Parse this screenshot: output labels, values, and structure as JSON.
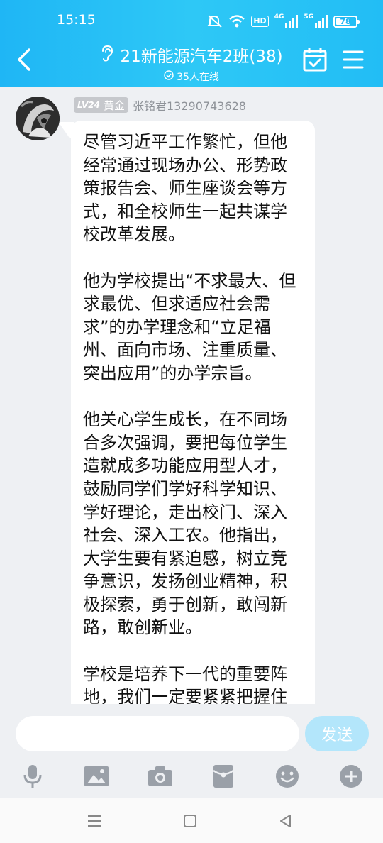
{
  "status_bar": {
    "time": "15:15",
    "network_hd": "HD",
    "net_4g": "4G",
    "net_5g": "5G",
    "battery": "78",
    "battery_level": 0.78
  },
  "header": {
    "title": "21新能源汽车2班(38)",
    "online": "35人在线"
  },
  "message": {
    "level": "LV24",
    "rank": "黄金",
    "sender": "张铭君13290743628",
    "paragraphs": [
      "尽管习近平工作繁忙，但他经常通过现场办公、形势政策报告会、师生座谈会等方式，和全校师生一起共谋学校改革发展。",
      "他为学校提出“不求最大、但求最优、但求适应社会需求”的办学理念和“立足福州、面向市场、注重质量、突出应用”的办学宗旨。",
      "他关心学生成长，在不同场合多次强调，要把每位学生造就成多功能应用型人才，鼓励同学们学好科学知识、学好理论，走出校门、深入社会、深入工农。他指出，大学生要有紧迫感，树立竞争意识，发扬创业精神，积极探索，勇于创新，敢闯新路，敢创新业。",
      "学校是培养下一代的重要阵地，我们一定要紧紧把握住现代大学生的特点，以四项基本原则为主导思想，多形"
    ]
  },
  "input": {
    "value": "",
    "send_label": "发送"
  },
  "colors": {
    "header_start": "#1fb6f5",
    "header_end": "#2ec8f6",
    "send_disabled": "#b3e6fb",
    "chat_bg": "#eef0f3"
  }
}
